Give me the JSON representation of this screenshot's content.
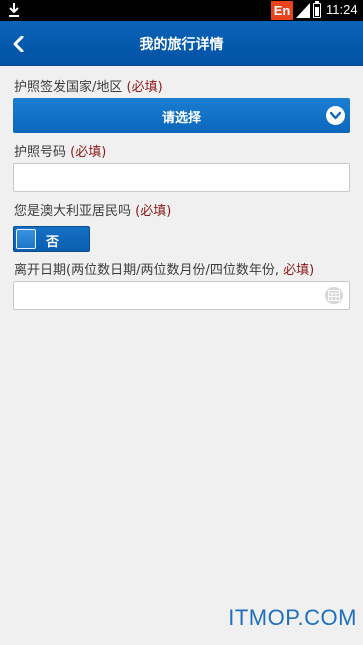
{
  "status_bar": {
    "time": "11:24",
    "input_method_badge": "En",
    "icons": [
      "download-icon",
      "signal-icon",
      "battery-icon"
    ]
  },
  "header": {
    "title": "我的旅行详情",
    "back_icon": "chevron-left-icon",
    "background_color": "#0659ab"
  },
  "form": {
    "issuing_country": {
      "label": "护照签发国家/地区",
      "required_text": "(必填)",
      "value": "请选择"
    },
    "passport_number": {
      "label": "护照号码",
      "required_text": "(必填)",
      "value": ""
    },
    "australian_resident": {
      "label": "您是澳大利亚居民吗",
      "required_text": "(必填)",
      "value": "否"
    },
    "departure_date": {
      "label": "离开日期(两位数日期/两位数月份/四位数年份,",
      "required_text": "必填)",
      "value": "",
      "icon": "calendar-icon"
    }
  },
  "watermark": "ITMOP.COM",
  "colors": {
    "accent": "#0b67bb",
    "required": "#8b1a1a",
    "watermark": "#1f6fbf"
  }
}
